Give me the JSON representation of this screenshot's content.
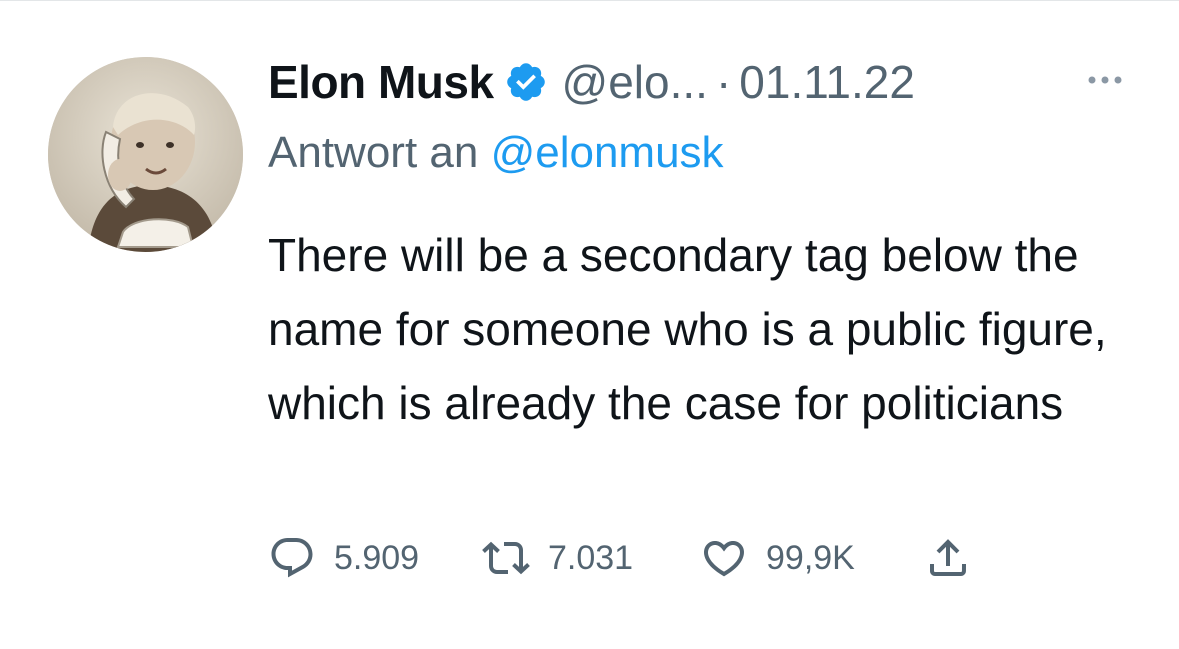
{
  "tweet": {
    "author": {
      "name": "Elon Musk",
      "handle": "@elo...",
      "verified": true,
      "avatar_icon": "profile-photo"
    },
    "separator": "·",
    "date": "01.11.22",
    "more_icon": "more-dots-icon",
    "reply_to": {
      "prefix": "Antwort an",
      "mention": "@elonmusk"
    },
    "text": "There will be a secondary tag below the name for someone who is a public figure, which is already the case for politicians",
    "stats": {
      "replies": "5.909",
      "retweets": "7.031",
      "likes": "99,9K"
    }
  },
  "colors": {
    "text": "#0f1419",
    "secondary": "#536471",
    "link": "#1d9bf0",
    "verified": "#1d9bf0"
  }
}
